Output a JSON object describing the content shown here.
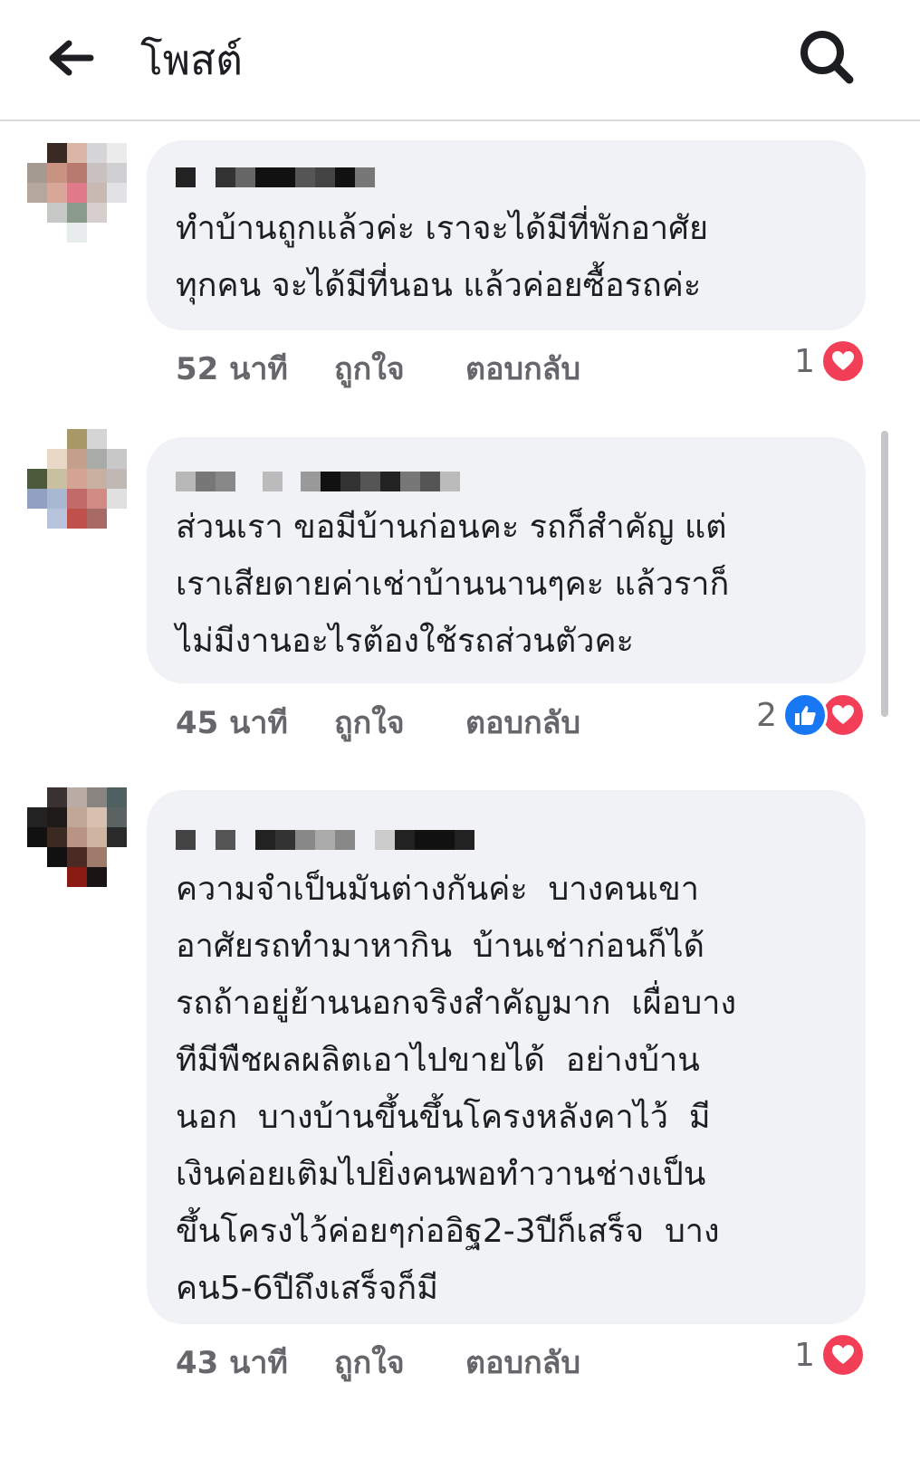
{
  "header": {
    "title": "โพสต์",
    "back_icon": "arrow-left-icon",
    "search_icon": "search-icon"
  },
  "colors": {
    "bubble": "#f0f2f5",
    "meta_text": "#65676b",
    "love": "#f33e58",
    "like": "#1877f2"
  },
  "comments": [
    {
      "text": "ทำบ้านถูกแล้วค่ะ เราจะได้มีที่พักอาศัย\nทุกคน จะได้มีที่นอน แล้วค่อยซื้อรถค่ะ",
      "time": "52 นาที",
      "like_label": "ถูกใจ",
      "reply_label": "ตอบกลับ",
      "reaction_count": "1",
      "reactions": [
        "love"
      ]
    },
    {
      "text": "ส่วนเรา ขอมีบ้านก่อนคะ รถก็สำคัญ แต่\nเราเสียดายค่าเช่าบ้านนานๆคะ แล้วราก็\nไม่มีงานอะไรต้องใช้รถส่วนตัวคะ",
      "time": "45 นาที",
      "like_label": "ถูกใจ",
      "reply_label": "ตอบกลับ",
      "reaction_count": "2",
      "reactions": [
        "like",
        "love"
      ]
    },
    {
      "text": "ความจำเป็นมันต่างกันค่ะ  บางคนเขา\nอาศัยรถทำมาหากิน  บ้านเช่าก่อนก็ได้\nรถถ้าอยู่ย้านนอกจริงสำคัญมาก  เผื่อบาง\nทีมีพืชผลผลิตเอาไปขายได้  อย่างบ้าน\nนอก  บางบ้านขึ้นขึ้นโครงหลังคาไว้  มี\nเงินค่อยเติมไปยิ่งคนพอทำวานช่างเป็น\nขึ้นโครงไว้ค่อยๆก่ออิฐ2-3ปีก็เสร็จ  บาง\nคน5-6ปีถึงเสร็จก็มี",
      "time": "43 นาที",
      "like_label": "ถูกใจ",
      "reply_label": "ตอบกลับ",
      "reaction_count": "1",
      "reactions": [
        "love"
      ]
    }
  ]
}
